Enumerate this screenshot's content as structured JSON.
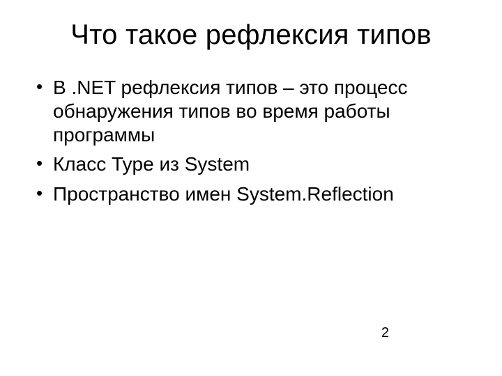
{
  "slide": {
    "title": "Что такое рефлексия типов",
    "bullets": [
      "В .NET рефлексия типов – это процесс обнаружения типов во время работы программы",
      "Класс Type из System",
      "Пространство имен System.Reflection"
    ],
    "page_number": "2"
  }
}
